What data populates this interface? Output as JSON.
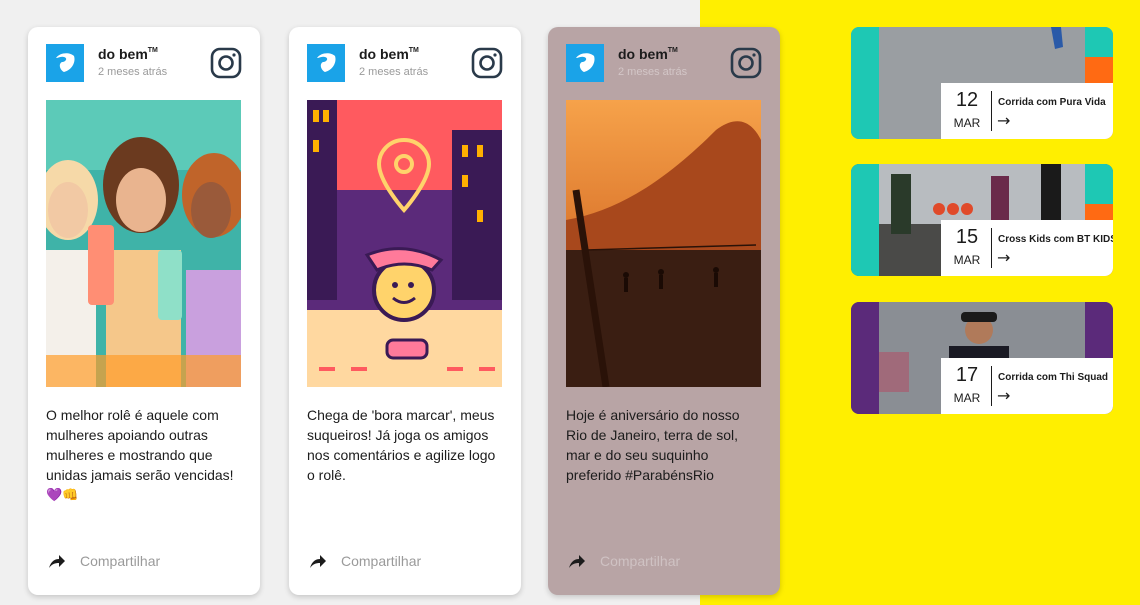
{
  "brand": {
    "name": "do bem",
    "mark": "TM"
  },
  "icons": {
    "avatar": "bird-logo-icon",
    "instagram": "instagram-icon",
    "share": "share-arrow-icon",
    "arrow": "arrow-right-icon"
  },
  "colors": {
    "yellow": "#ffef00",
    "brand_blue": "#1aa3e8",
    "teal": "#1ec8b4",
    "orange": "#ff6a13",
    "purple": "#5b2a7a"
  },
  "posts": [
    {
      "time": "2 meses atrás",
      "text": "O melhor rolê é aquele com mulheres apoiando outras mulheres e mostrando que unidas jamais serão vencidas!",
      "emojis": "💜👊",
      "share_label": "Compartilhar"
    },
    {
      "time": "2 meses atrás",
      "text": "Chega de 'bora marcar', meus suqueiros! Já joga os amigos nos comentários e agilize logo o rolê.",
      "share_label": "Compartilhar"
    },
    {
      "time": "2 meses atrás",
      "text": "Hoje é aniversário do nosso Rio de Janeiro, terra de sol, mar e do seu suquinho preferido #ParabénsRio",
      "share_label": "Compartilhar"
    }
  ],
  "events": [
    {
      "day": "12",
      "month": "MAR",
      "title": "Corrida com Pura Vida",
      "arrow": "→"
    },
    {
      "day": "15",
      "month": "MAR",
      "title": "Cross Kids com BT KIDS",
      "arrow": "→"
    },
    {
      "day": "17",
      "month": "MAR",
      "title": "Corrida com Thi Squad",
      "arrow": "→"
    }
  ]
}
